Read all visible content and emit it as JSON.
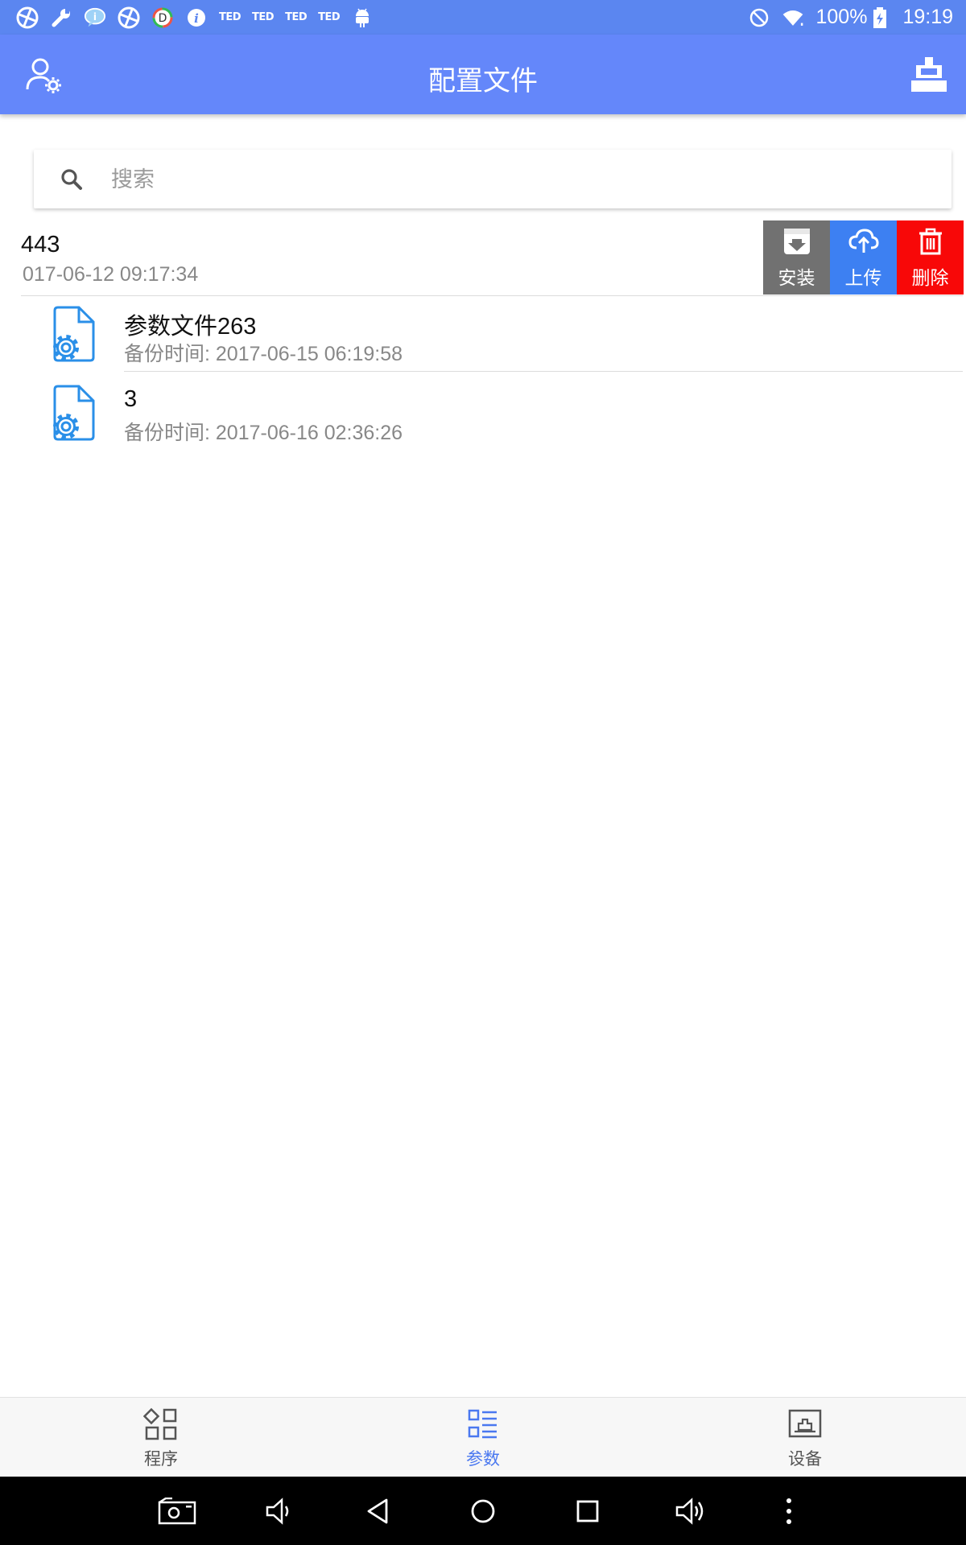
{
  "status_bar": {
    "battery": "100%",
    "time": "19:19",
    "ted_labels": [
      "TED",
      "TED",
      "TED",
      "TED"
    ],
    "info_glyph": "i",
    "d_glyph": "D"
  },
  "app_bar": {
    "title": "配置文件",
    "left_icon": "user-settings-icon",
    "right_icon": "robot-icon"
  },
  "search": {
    "placeholder": "搜索",
    "value": ""
  },
  "files": [
    {
      "title": "443",
      "subtitle": "017-06-12 09:17:34",
      "swiped": true,
      "actions": [
        {
          "label": "安装",
          "icon": "install-icon",
          "color": "#717171"
        },
        {
          "label": "上传",
          "icon": "cloud-upload-icon",
          "color": "#3d80f2"
        },
        {
          "label": "删除",
          "icon": "trash-icon",
          "color": "#f80808"
        }
      ]
    },
    {
      "title": "参数文件263",
      "subtitle": "备份时间: 2017-06-15 06:19:58",
      "swiped": false
    },
    {
      "title": "3",
      "subtitle": "备份时间: 2017-06-16 02:36:26",
      "swiped": false
    }
  ],
  "bottom_nav": [
    {
      "label": "程序",
      "icon": "program-icon",
      "active": false
    },
    {
      "label": "参数",
      "icon": "parameter-icon",
      "active": true
    },
    {
      "label": "设备",
      "icon": "device-icon",
      "active": false
    }
  ],
  "colors": {
    "accent": "#6487fa",
    "status_bar": "#5b86f0",
    "active_nav": "#4a78f0",
    "file_icon": "#2a8fe8"
  }
}
